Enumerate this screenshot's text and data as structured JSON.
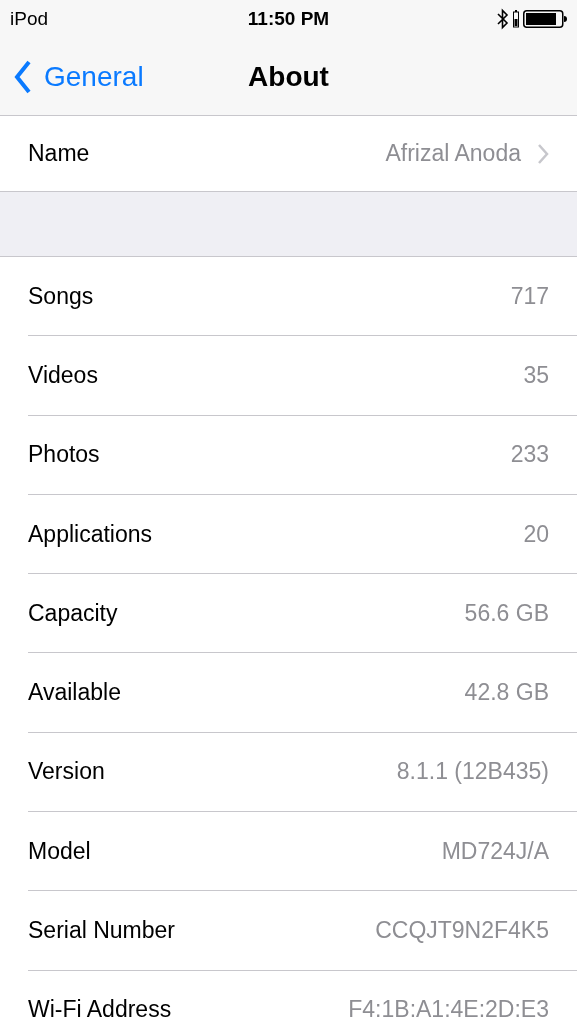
{
  "status_bar": {
    "carrier": "iPod",
    "time": "11:50 PM"
  },
  "nav": {
    "back": "General",
    "title": "About"
  },
  "name_row": {
    "label": "Name",
    "value": "Afrizal Anoda"
  },
  "rows": [
    {
      "label": "Songs",
      "value": "717"
    },
    {
      "label": "Videos",
      "value": "35"
    },
    {
      "label": "Photos",
      "value": "233"
    },
    {
      "label": "Applications",
      "value": "20"
    },
    {
      "label": "Capacity",
      "value": "56.6 GB"
    },
    {
      "label": "Available",
      "value": "42.8 GB"
    },
    {
      "label": "Version",
      "value": "8.1.1 (12B435)"
    },
    {
      "label": "Model",
      "value": "MD724J/A"
    },
    {
      "label": "Serial Number",
      "value": "CCQJT9N2F4K5"
    },
    {
      "label": "Wi-Fi Address",
      "value": "F4:1B:A1:4E:2D:E3"
    }
  ]
}
